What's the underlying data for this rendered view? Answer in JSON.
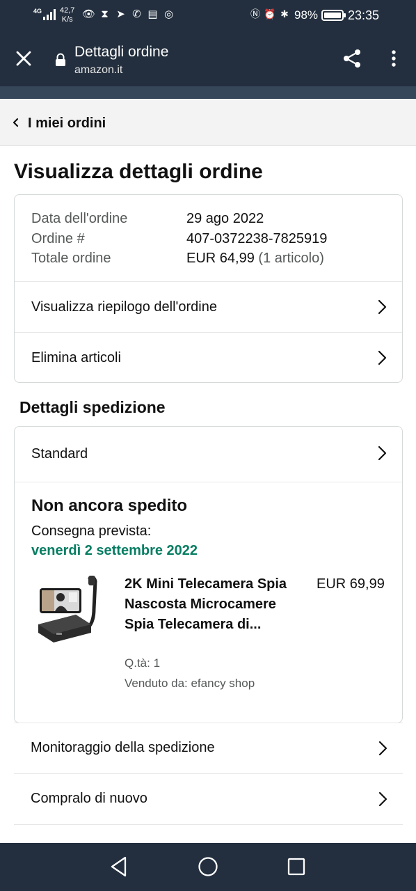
{
  "status_bar": {
    "network": "4G",
    "speed_value": "42,7",
    "speed_unit": "K/s",
    "battery": "98%",
    "battery_level": 0.98,
    "time": "23:35"
  },
  "browser": {
    "title": "Dettagli ordine",
    "domain": "amazon.it",
    "icons": [
      "close-icon",
      "lock-icon",
      "share-icon",
      "more-icon"
    ]
  },
  "breadcrumb": {
    "label": "I miei ordini"
  },
  "page_title": "Visualizza dettagli ordine",
  "order": {
    "date_label": "Data dell'ordine",
    "date_value": "29 ago 2022",
    "number_label": "Ordine #",
    "number_value": "407-0372238-7825919",
    "total_label": "Totale ordine",
    "total_value": "EUR 64,99",
    "total_items": "(1 articolo)"
  },
  "order_links": [
    {
      "label": "Visualizza riepilogo dell'ordine"
    },
    {
      "label": "Elimina articoli"
    }
  ],
  "shipping": {
    "section_title": "Dettagli spedizione",
    "method": "Standard",
    "status": "Non ancora spedito",
    "delivery_label": "Consegna prevista:",
    "delivery_date": "venerdì 2 settembre 2022",
    "delivery_color": "#067d62"
  },
  "product": {
    "name": "2K Mini Telecamera Spia Nascosta Microcamere Spia Telecamera di...",
    "price": "EUR 69,99",
    "qty": "Q.tà: 1",
    "seller": "Venduto da: efancy shop"
  },
  "shipment_links": [
    {
      "label": "Monitoraggio della spedizione"
    },
    {
      "label": "Compralo di nuovo"
    }
  ],
  "colors": {
    "header": "#232f3e",
    "accent_green": "#067d62"
  }
}
